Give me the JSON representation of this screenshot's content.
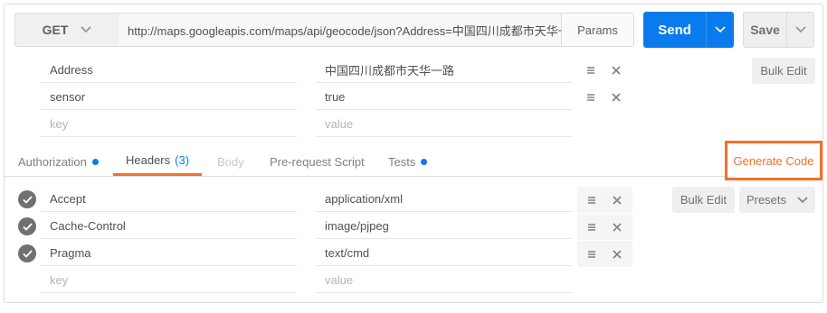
{
  "request": {
    "method": "GET",
    "url": "http://maps.googleapis.com/maps/api/geocode/json?Address=中国四川成都市天华一路",
    "params_label": "Params",
    "send_label": "Send",
    "save_label": "Save"
  },
  "params": {
    "rows": [
      {
        "key": "Address",
        "value": "中国四川成都市天华一路"
      },
      {
        "key": "sensor",
        "value": "true"
      }
    ],
    "placeholder_key": "key",
    "placeholder_value": "value",
    "bulk_edit_label": "Bulk Edit"
  },
  "tabs": {
    "authorization": "Authorization",
    "headers": "Headers",
    "headers_count": "(3)",
    "body": "Body",
    "prerequest": "Pre-request Script",
    "tests": "Tests"
  },
  "generate_code_label": "Generate Code",
  "headers": {
    "rows": [
      {
        "key": "Accept",
        "value": "application/xml",
        "enabled": true
      },
      {
        "key": "Cache-Control",
        "value": "image/pjpeg",
        "enabled": true
      },
      {
        "key": "Pragma",
        "value": "text/cmd",
        "enabled": true
      }
    ],
    "placeholder_key": "key",
    "placeholder_value": "value",
    "bulk_edit_label": "Bulk Edit",
    "presets_label": "Presets"
  },
  "colors": {
    "accent_send": "#097bed",
    "accent_orange": "#f47023",
    "check_enabled": "#707070"
  },
  "icons": [
    "chevron-down-icon",
    "drag-handle-icon",
    "close-icon",
    "check-icon"
  ]
}
